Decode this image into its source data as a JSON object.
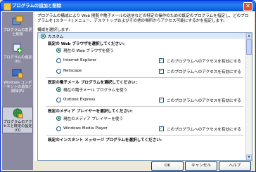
{
  "window": {
    "title": "プログラムの追加と削除",
    "close_glyph": "✕"
  },
  "sidebar": {
    "items": [
      {
        "label": "プログラムの変更と削除",
        "icon": "change-remove-programs-icon"
      },
      {
        "label": "プログラムの追加(N)",
        "icon": "add-programs-icon"
      },
      {
        "label": "Windows コンポーネントの追加と削除(A)",
        "icon": "windows-components-icon"
      },
      {
        "label": "プログラムのアクセスと既定の設定(O)",
        "icon": "program-access-icon",
        "selected": true
      }
    ]
  },
  "content": {
    "description": "プログラムの構成により Web 閲覧や電子メールの送信などの特定の操作のための既定のプログラムを指定し、どのプログラムを [スタート] メニュー、デスクトップおよびその他の場所からアクセス可能にするかを指定します。",
    "config_label": "構成を選択します:",
    "custom_label": "カスタム",
    "sections": {
      "browser": {
        "heading": "既定の Web ブラウザを選択してください:",
        "opt_current": "現在の Web ブラウザを使う",
        "opt_ie": "Internet Explorer",
        "opt_netscape": "Netscape",
        "enable_label": "このプログラムへのアクセスを有効にする"
      },
      "email": {
        "heading": "既定の電子メール プログラムを選択してください:",
        "opt_current": "現在の電子メール プログラムを使う",
        "opt_outlook": "Outlook Express",
        "enable_label": "このプログラムへのアクセスを有効にする"
      },
      "media": {
        "heading": "既定のメディア プレイヤーを選択してください:",
        "opt_current": "現在のメディア プレイヤーを使う",
        "opt_wmp": "Windows Media Player",
        "enable_label": "このプログラムへのアクセスを有効にする"
      },
      "im": {
        "heading": "既定のインスタント メッセージ プログラムを選択してください:"
      }
    }
  },
  "buttons": {
    "ok": "OK",
    "cancel": "キャンセル",
    "help": "ヘルプ"
  },
  "colors": {
    "titlebar": "#0a5fe8",
    "sidebar": "#8c8aa1",
    "accent_check": "#21a121"
  }
}
